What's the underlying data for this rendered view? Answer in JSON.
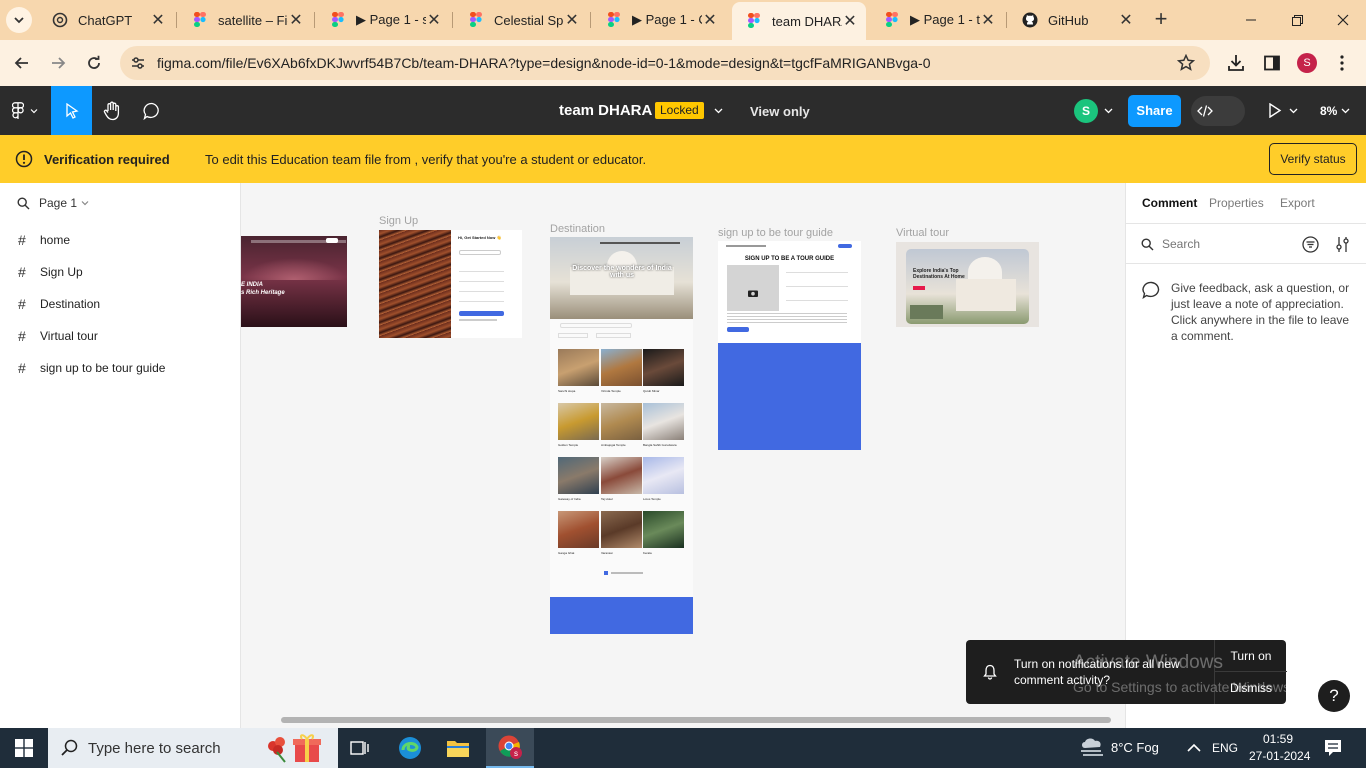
{
  "browser": {
    "tabs": [
      {
        "title": "ChatGPT",
        "icon": "chatgpt-icon"
      },
      {
        "title": "satellite – Fig",
        "icon": "figma-icon"
      },
      {
        "title": "▶ Page 1 - s",
        "icon": "figma-icon"
      },
      {
        "title": "Celestial Spc",
        "icon": "figma-icon"
      },
      {
        "title": "▶ Page 1 - C",
        "icon": "figma-icon"
      },
      {
        "title": "team DHARA",
        "icon": "figma-icon"
      },
      {
        "title": "▶ Page 1 - t",
        "icon": "figma-icon"
      },
      {
        "title": "GitHub",
        "icon": "github-icon"
      }
    ],
    "active_tab_index": 5,
    "url": "figma.com/file/Ev6XAb6fxDKJwvrf54B7Cb/team-DHARA?type=design&node-id=0-1&mode=design&t=tgcfFaMRIGANBvga-0",
    "profile_initial": "S"
  },
  "figma": {
    "file_title": "team DHARA",
    "locked_label": "Locked",
    "view_only_label": "View only",
    "user_initial": "S",
    "share_label": "Share",
    "zoom_label": "8%"
  },
  "banner": {
    "title": "Verification required",
    "message": "To edit this Education team file from , verify that you're a student or educator.",
    "button_label": "Verify status"
  },
  "left_panel": {
    "page_label": "Page 1",
    "layers": [
      "home",
      "Sign Up",
      "Destination",
      "Virtual tour",
      "sign up to be tour guide"
    ]
  },
  "canvas": {
    "frames": [
      {
        "label": "",
        "heading": "E INDIA",
        "subheading": "s Rich Heritage"
      },
      {
        "label": "Sign Up",
        "heading": "Hi, Get Started Now 👋"
      },
      {
        "label": "Destination",
        "heading": "Discover the wonders of India with us"
      },
      {
        "label": "sign up to be tour guide",
        "heading": "SIGN UP TO BE A TOUR GUIDE"
      },
      {
        "label": "Virtual tour",
        "heading": "Explore India's Top Destinations At Home"
      }
    ],
    "destination_cards": [
      "Sanchi stupa",
      "Virinda Temple",
      "Qutub Minar",
      "Golden Temple",
      "Ambajogai Temple",
      "Bangla Sahib Gurudwara",
      "Gateway of India",
      "Taj Hotel",
      "Lotus Temple",
      "Ganga Ghat",
      "Varanasi",
      "Kerala"
    ]
  },
  "right_panel": {
    "tabs": [
      "Comment",
      "Properties",
      "Export"
    ],
    "search_placeholder": "Search",
    "help_text": "Give feedback, ask a question, or just leave a note of appreciation. Click anywhere in the file to leave a comment."
  },
  "toast": {
    "message": "Turn on notifications for all new comment activity?",
    "turn_on_label": "Turn on",
    "dismiss_label": "Dismiss"
  },
  "watermark": {
    "title": "Activate Windows",
    "subtitle": "Go to Settings to activate Windows."
  },
  "taskbar": {
    "search_placeholder": "Type here to search",
    "weather": "8°C  Fog",
    "language": "ENG",
    "time": "01:59",
    "date": "27-01-2024"
  },
  "colors": {
    "accent": "#0d99ff",
    "banner": "#ffcd29",
    "toolbar": "#2c2c2c",
    "locked": "#ffc700",
    "blue_block": "#4169e1"
  }
}
